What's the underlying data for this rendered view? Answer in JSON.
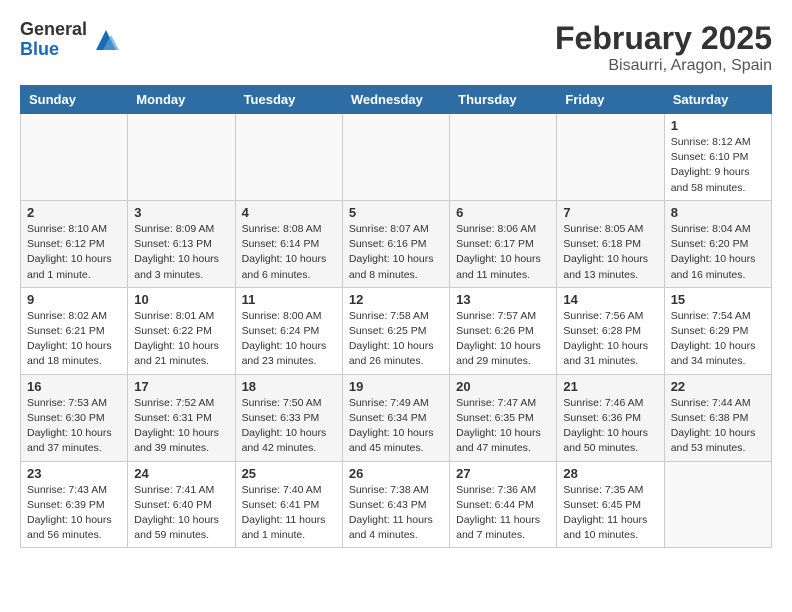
{
  "header": {
    "logo_general": "General",
    "logo_blue": "Blue",
    "title": "February 2025",
    "location": "Bisaurri, Aragon, Spain"
  },
  "weekdays": [
    "Sunday",
    "Monday",
    "Tuesday",
    "Wednesday",
    "Thursday",
    "Friday",
    "Saturday"
  ],
  "weeks": [
    [
      {
        "day": "",
        "info": ""
      },
      {
        "day": "",
        "info": ""
      },
      {
        "day": "",
        "info": ""
      },
      {
        "day": "",
        "info": ""
      },
      {
        "day": "",
        "info": ""
      },
      {
        "day": "",
        "info": ""
      },
      {
        "day": "1",
        "info": "Sunrise: 8:12 AM\nSunset: 6:10 PM\nDaylight: 9 hours and 58 minutes."
      }
    ],
    [
      {
        "day": "2",
        "info": "Sunrise: 8:10 AM\nSunset: 6:12 PM\nDaylight: 10 hours and 1 minute."
      },
      {
        "day": "3",
        "info": "Sunrise: 8:09 AM\nSunset: 6:13 PM\nDaylight: 10 hours and 3 minutes."
      },
      {
        "day": "4",
        "info": "Sunrise: 8:08 AM\nSunset: 6:14 PM\nDaylight: 10 hours and 6 minutes."
      },
      {
        "day": "5",
        "info": "Sunrise: 8:07 AM\nSunset: 6:16 PM\nDaylight: 10 hours and 8 minutes."
      },
      {
        "day": "6",
        "info": "Sunrise: 8:06 AM\nSunset: 6:17 PM\nDaylight: 10 hours and 11 minutes."
      },
      {
        "day": "7",
        "info": "Sunrise: 8:05 AM\nSunset: 6:18 PM\nDaylight: 10 hours and 13 minutes."
      },
      {
        "day": "8",
        "info": "Sunrise: 8:04 AM\nSunset: 6:20 PM\nDaylight: 10 hours and 16 minutes."
      }
    ],
    [
      {
        "day": "9",
        "info": "Sunrise: 8:02 AM\nSunset: 6:21 PM\nDaylight: 10 hours and 18 minutes."
      },
      {
        "day": "10",
        "info": "Sunrise: 8:01 AM\nSunset: 6:22 PM\nDaylight: 10 hours and 21 minutes."
      },
      {
        "day": "11",
        "info": "Sunrise: 8:00 AM\nSunset: 6:24 PM\nDaylight: 10 hours and 23 minutes."
      },
      {
        "day": "12",
        "info": "Sunrise: 7:58 AM\nSunset: 6:25 PM\nDaylight: 10 hours and 26 minutes."
      },
      {
        "day": "13",
        "info": "Sunrise: 7:57 AM\nSunset: 6:26 PM\nDaylight: 10 hours and 29 minutes."
      },
      {
        "day": "14",
        "info": "Sunrise: 7:56 AM\nSunset: 6:28 PM\nDaylight: 10 hours and 31 minutes."
      },
      {
        "day": "15",
        "info": "Sunrise: 7:54 AM\nSunset: 6:29 PM\nDaylight: 10 hours and 34 minutes."
      }
    ],
    [
      {
        "day": "16",
        "info": "Sunrise: 7:53 AM\nSunset: 6:30 PM\nDaylight: 10 hours and 37 minutes."
      },
      {
        "day": "17",
        "info": "Sunrise: 7:52 AM\nSunset: 6:31 PM\nDaylight: 10 hours and 39 minutes."
      },
      {
        "day": "18",
        "info": "Sunrise: 7:50 AM\nSunset: 6:33 PM\nDaylight: 10 hours and 42 minutes."
      },
      {
        "day": "19",
        "info": "Sunrise: 7:49 AM\nSunset: 6:34 PM\nDaylight: 10 hours and 45 minutes."
      },
      {
        "day": "20",
        "info": "Sunrise: 7:47 AM\nSunset: 6:35 PM\nDaylight: 10 hours and 47 minutes."
      },
      {
        "day": "21",
        "info": "Sunrise: 7:46 AM\nSunset: 6:36 PM\nDaylight: 10 hours and 50 minutes."
      },
      {
        "day": "22",
        "info": "Sunrise: 7:44 AM\nSunset: 6:38 PM\nDaylight: 10 hours and 53 minutes."
      }
    ],
    [
      {
        "day": "23",
        "info": "Sunrise: 7:43 AM\nSunset: 6:39 PM\nDaylight: 10 hours and 56 minutes."
      },
      {
        "day": "24",
        "info": "Sunrise: 7:41 AM\nSunset: 6:40 PM\nDaylight: 10 hours and 59 minutes."
      },
      {
        "day": "25",
        "info": "Sunrise: 7:40 AM\nSunset: 6:41 PM\nDaylight: 11 hours and 1 minute."
      },
      {
        "day": "26",
        "info": "Sunrise: 7:38 AM\nSunset: 6:43 PM\nDaylight: 11 hours and 4 minutes."
      },
      {
        "day": "27",
        "info": "Sunrise: 7:36 AM\nSunset: 6:44 PM\nDaylight: 11 hours and 7 minutes."
      },
      {
        "day": "28",
        "info": "Sunrise: 7:35 AM\nSunset: 6:45 PM\nDaylight: 11 hours and 10 minutes."
      },
      {
        "day": "",
        "info": ""
      }
    ]
  ]
}
